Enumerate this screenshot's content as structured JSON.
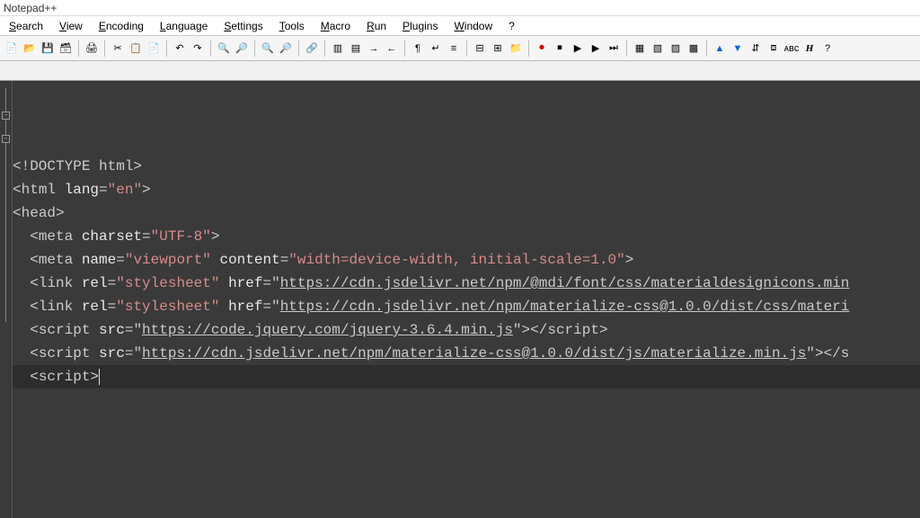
{
  "app": {
    "title": "Notepad++"
  },
  "menu": {
    "items": [
      {
        "label": "Search",
        "ul": "S"
      },
      {
        "label": "View",
        "ul": "V"
      },
      {
        "label": "Encoding",
        "ul": "E"
      },
      {
        "label": "Language",
        "ul": "L"
      },
      {
        "label": "Settings",
        "ul": "S"
      },
      {
        "label": "Tools",
        "ul": "T"
      },
      {
        "label": "Macro",
        "ul": "M"
      },
      {
        "label": "Run",
        "ul": "R"
      },
      {
        "label": "Plugins",
        "ul": "P"
      },
      {
        "label": "Window",
        "ul": "W"
      },
      {
        "label": "?",
        "ul": "?"
      }
    ]
  },
  "toolbar_icons": [
    "new",
    "open",
    "save",
    "save-all",
    "|",
    "print",
    "|",
    "cut",
    "copy",
    "paste",
    "|",
    "undo",
    "redo",
    "|",
    "find",
    "replace",
    "|",
    "zoom-in",
    "zoom-out",
    "|",
    "sync",
    "|",
    "ww1",
    "ww2",
    "indent",
    "outdent",
    "|",
    "para",
    "eol",
    "indent-guide",
    "|",
    "fold",
    "unfold",
    "folder",
    "|",
    "rec",
    "stop",
    "play",
    "play2",
    "ffwd",
    "|",
    "p1",
    "p2",
    "p3",
    "p4",
    "|",
    "up",
    "down",
    "dup",
    "bm",
    "abc",
    "H",
    "?"
  ],
  "code": {
    "lines": [
      {
        "indent": 0,
        "parts": [
          {
            "t": "ang",
            "v": "<!"
          },
          {
            "t": "tag",
            "v": "DOCTYPE html"
          },
          {
            "t": "ang",
            "v": ">"
          }
        ]
      },
      {
        "indent": 0,
        "parts": [
          {
            "t": "ang",
            "v": "<"
          },
          {
            "t": "tag",
            "v": "html"
          },
          {
            "t": "punc",
            "v": " "
          },
          {
            "t": "attrname",
            "v": "lang"
          },
          {
            "t": "punc",
            "v": "="
          },
          {
            "t": "attrval",
            "v": "\"en\""
          },
          {
            "t": "ang",
            "v": ">"
          }
        ]
      },
      {
        "indent": 0,
        "parts": [
          {
            "t": "ang",
            "v": "<"
          },
          {
            "t": "tag",
            "v": "head"
          },
          {
            "t": "ang",
            "v": ">"
          }
        ]
      },
      {
        "indent": 1,
        "parts": [
          {
            "t": "ang",
            "v": "<"
          },
          {
            "t": "tag",
            "v": "meta"
          },
          {
            "t": "punc",
            "v": " "
          },
          {
            "t": "attrname",
            "v": "charset"
          },
          {
            "t": "punc",
            "v": "="
          },
          {
            "t": "attrval",
            "v": "\"UTF-8\""
          },
          {
            "t": "ang",
            "v": ">"
          }
        ]
      },
      {
        "indent": 1,
        "parts": [
          {
            "t": "ang",
            "v": "<"
          },
          {
            "t": "tag",
            "v": "meta"
          },
          {
            "t": "punc",
            "v": " "
          },
          {
            "t": "attrname",
            "v": "name"
          },
          {
            "t": "punc",
            "v": "="
          },
          {
            "t": "attrval",
            "v": "\"viewport\""
          },
          {
            "t": "punc",
            "v": " "
          },
          {
            "t": "attrname",
            "v": "content"
          },
          {
            "t": "punc",
            "v": "="
          },
          {
            "t": "attrval",
            "v": "\"width=device-width, initial-scale=1.0\""
          },
          {
            "t": "ang",
            "v": ">"
          }
        ]
      },
      {
        "indent": 1,
        "parts": [
          {
            "t": "ang",
            "v": "<"
          },
          {
            "t": "tag",
            "v": "link"
          },
          {
            "t": "punc",
            "v": " "
          },
          {
            "t": "attrname",
            "v": "rel"
          },
          {
            "t": "punc",
            "v": "="
          },
          {
            "t": "attrval",
            "v": "\"stylesheet\""
          },
          {
            "t": "punc",
            "v": " "
          },
          {
            "t": "attrname",
            "v": "href"
          },
          {
            "t": "punc",
            "v": "=\""
          },
          {
            "t": "attrurl",
            "v": "https://cdn.jsdelivr.net/npm/@mdi/font/css/materialdesignicons.min"
          }
        ]
      },
      {
        "indent": 1,
        "parts": [
          {
            "t": "ang",
            "v": "<"
          },
          {
            "t": "tag",
            "v": "link"
          },
          {
            "t": "punc",
            "v": " "
          },
          {
            "t": "attrname",
            "v": "rel"
          },
          {
            "t": "punc",
            "v": "="
          },
          {
            "t": "attrval",
            "v": "\"stylesheet\""
          },
          {
            "t": "punc",
            "v": " "
          },
          {
            "t": "attrname",
            "v": "href"
          },
          {
            "t": "punc",
            "v": "=\""
          },
          {
            "t": "attrurl",
            "v": "https://cdn.jsdelivr.net/npm/materialize-css@1.0.0/dist/css/materi"
          }
        ]
      },
      {
        "indent": 1,
        "parts": [
          {
            "t": "ang",
            "v": "<"
          },
          {
            "t": "tag",
            "v": "script"
          },
          {
            "t": "punc",
            "v": " "
          },
          {
            "t": "attrname",
            "v": "src"
          },
          {
            "t": "punc",
            "v": "=\""
          },
          {
            "t": "attrurl",
            "v": "https://code.jquery.com/jquery-3.6.4.min.js"
          },
          {
            "t": "punc",
            "v": "\""
          },
          {
            "t": "ang",
            "v": ">"
          },
          {
            "t": "ang",
            "v": "</"
          },
          {
            "t": "tag",
            "v": "script"
          },
          {
            "t": "ang",
            "v": ">"
          }
        ]
      },
      {
        "indent": 1,
        "parts": [
          {
            "t": "ang",
            "v": "<"
          },
          {
            "t": "tag",
            "v": "script"
          },
          {
            "t": "punc",
            "v": " "
          },
          {
            "t": "attrname",
            "v": "src"
          },
          {
            "t": "punc",
            "v": "=\""
          },
          {
            "t": "attrurl",
            "v": "https://cdn.jsdelivr.net/npm/materialize-css@1.0.0/dist/js/materialize.min.js"
          },
          {
            "t": "punc",
            "v": "\""
          },
          {
            "t": "ang",
            "v": ">"
          },
          {
            "t": "ang",
            "v": "</"
          },
          {
            "t": "tag",
            "v": "s"
          }
        ]
      },
      {
        "indent": 1,
        "active": true,
        "parts": [
          {
            "t": "ang",
            "v": "<"
          },
          {
            "t": "tag",
            "v": "script"
          },
          {
            "t": "ang",
            "v": ">"
          }
        ],
        "cursor": true
      }
    ]
  }
}
